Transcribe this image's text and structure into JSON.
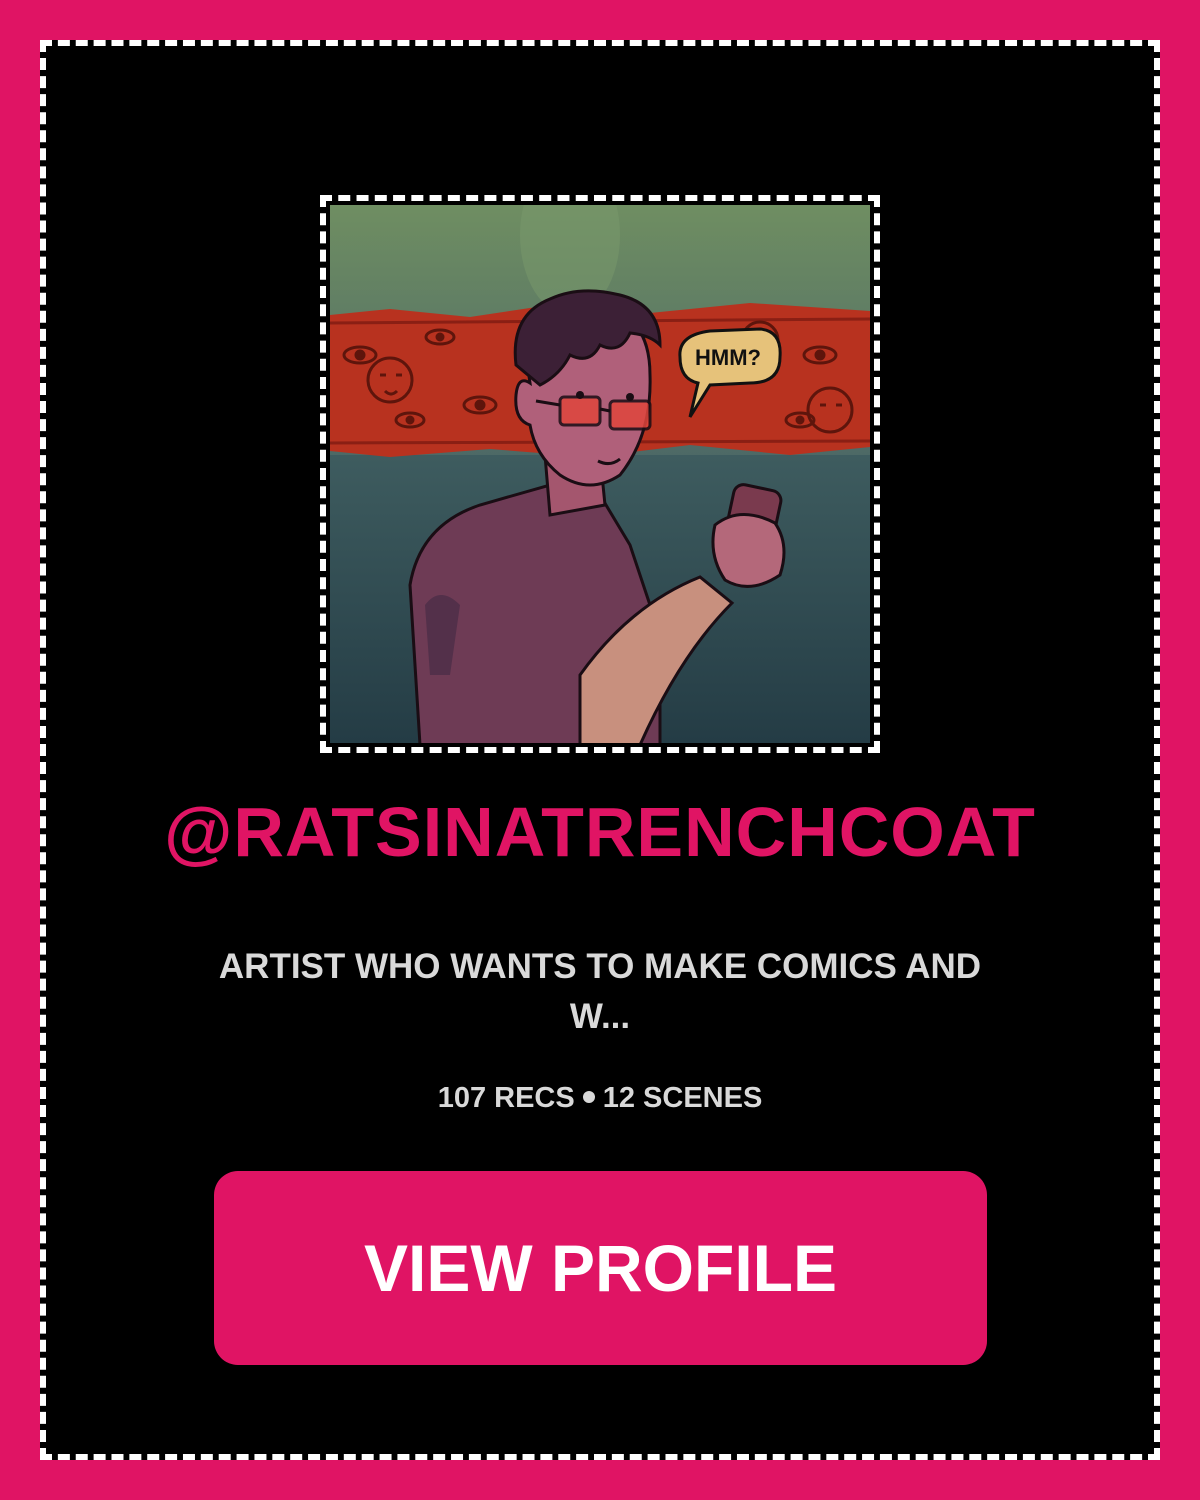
{
  "profile": {
    "avatar_icon": "illustrated-artist-avatar",
    "speech_bubble_text": "HMM?",
    "handle": "@RATSINATRENCHCOAT",
    "bio": "ARTIST WHO WANTS TO MAKE COMICS AND W...",
    "recs": "107 RECS",
    "scenes": "12 SCENES",
    "cta_label": "VIEW PROFILE"
  },
  "colors": {
    "accent": "#e01464",
    "background": "#000000",
    "text_muted": "#d9d9d9",
    "border": "#ffffff"
  }
}
